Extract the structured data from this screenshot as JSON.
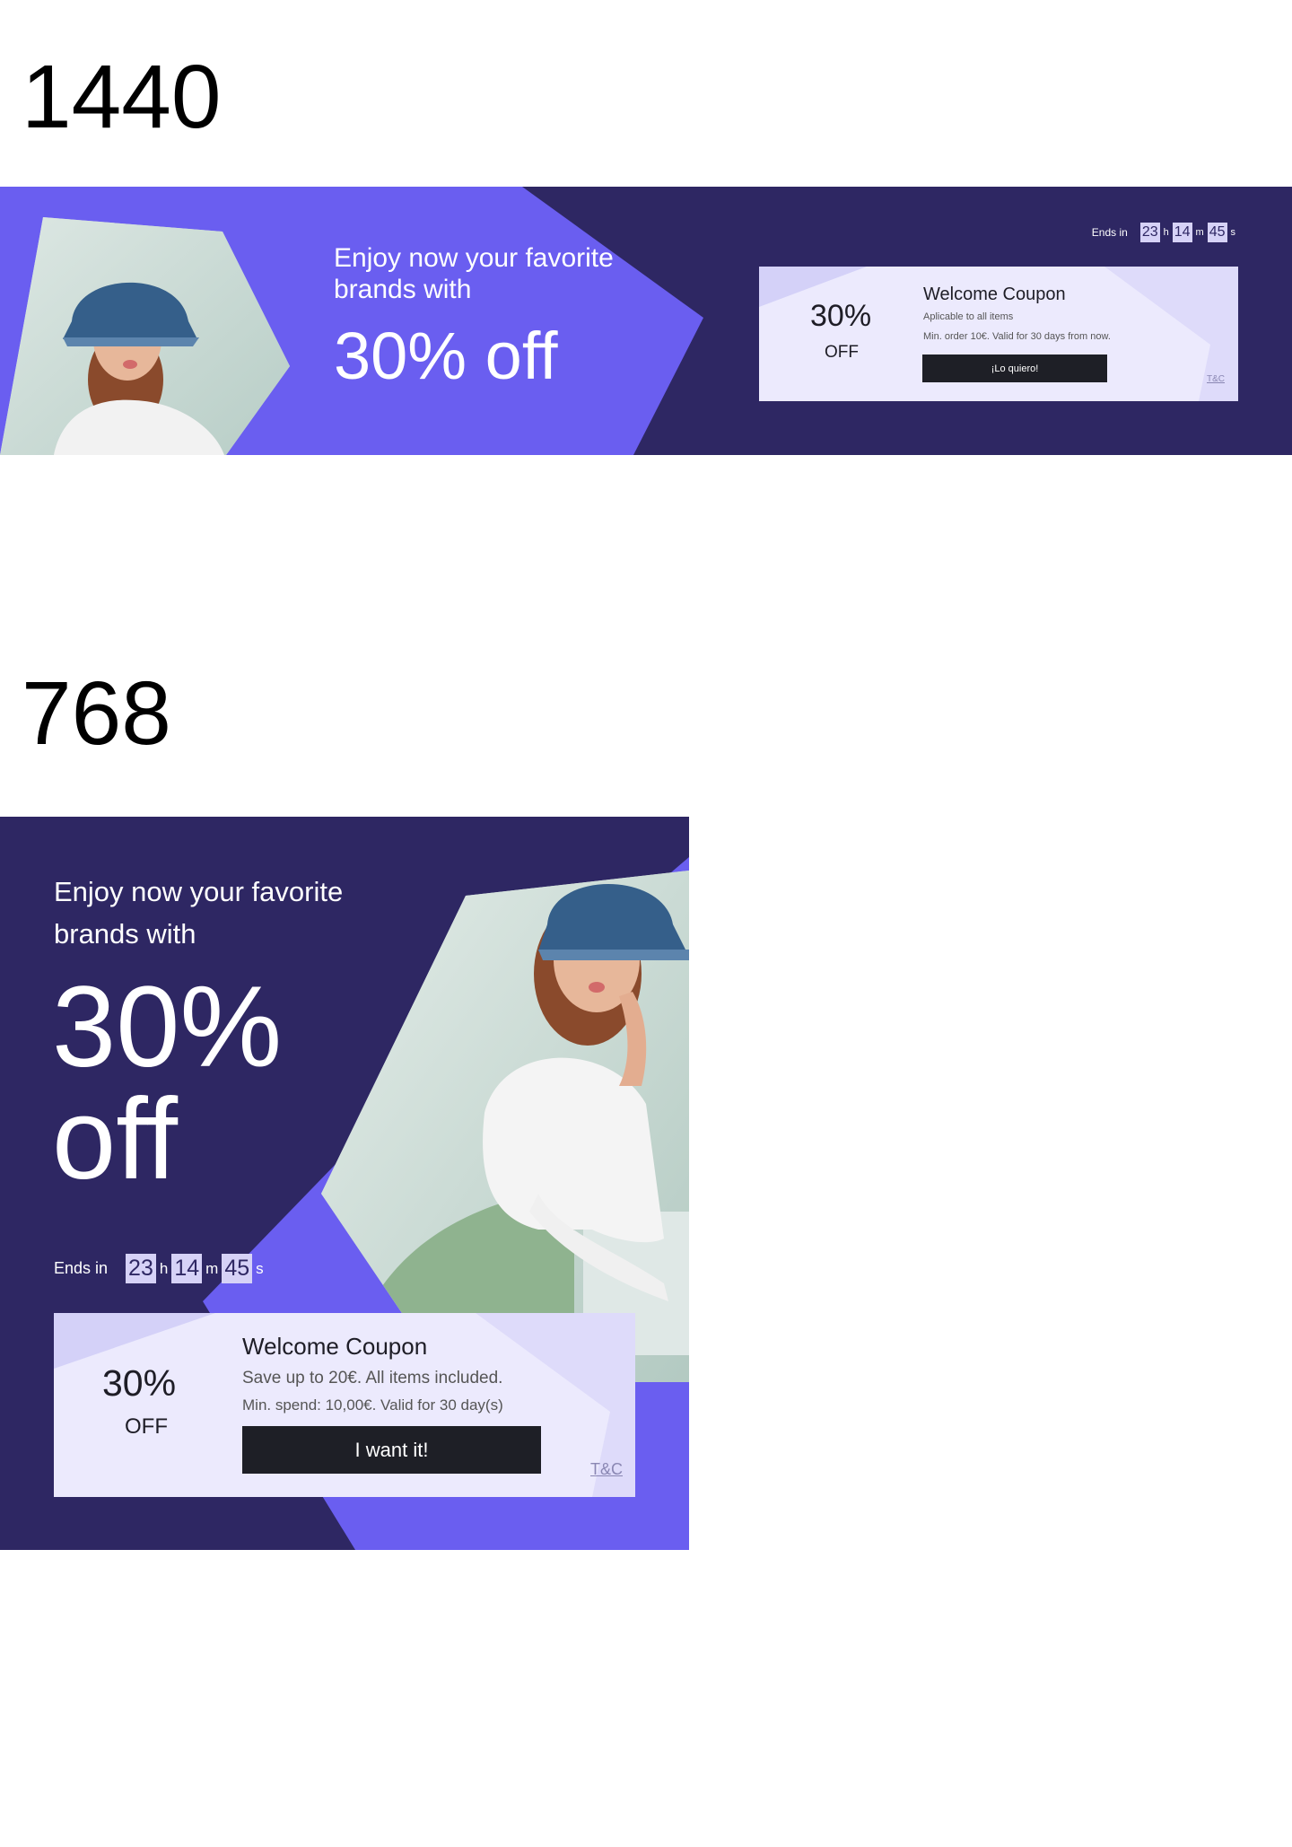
{
  "sections": [
    {
      "label": "1440"
    },
    {
      "label": "768"
    }
  ],
  "banner_desktop": {
    "headline": "Enjoy now your favorite brands with",
    "discount": "30% off",
    "timer": {
      "label": "Ends in",
      "hours": "23",
      "h": "h",
      "minutes": "14",
      "m": "m",
      "seconds": "45",
      "s": "s"
    },
    "coupon": {
      "percent": "30%",
      "off": "OFF",
      "title": "Welcome Coupon",
      "line1": "Aplicable to all items",
      "line2": "Min. order 10€. Valid for 30 days from now.",
      "button": "¡Lo quiero!",
      "tc": "T&C"
    }
  },
  "banner_tablet": {
    "headline": "Enjoy now your favorite brands with",
    "discount": "30% off",
    "timer": {
      "label": "Ends in",
      "hours": "23",
      "h": "h",
      "minutes": "14",
      "m": "m",
      "seconds": "45",
      "s": "s"
    },
    "coupon": {
      "percent": "30%",
      "off": "OFF",
      "title": "Welcome Coupon",
      "line1": "Save up to 20€. All items included.",
      "line2": "Min. spend: 10,00€. Valid for 30 day(s)",
      "button": "I want it!",
      "tc": "T&C"
    }
  },
  "colors": {
    "navy": "#2e2763",
    "purple": "#6a5ef0",
    "coupon_bg": "#eceafd",
    "button_bg": "#1e1f26",
    "timer_box": "#d6d2f7"
  },
  "icons": [
    "photo-woman-bucket-hat"
  ]
}
